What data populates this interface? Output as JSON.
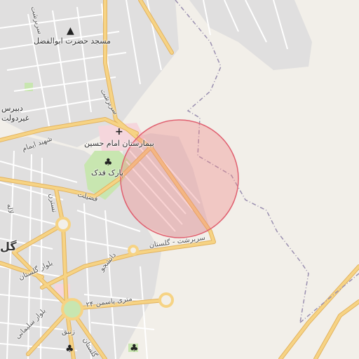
{
  "map": {
    "colors": {
      "background": "#f2efe9",
      "residential": "#e0dfdf",
      "road_major": "#f6d384",
      "road_casing": "#e3b35f",
      "road_minor": "#ffffff",
      "park": "#c8e6b0",
      "hospital": "#f5d6dc",
      "boundary": "#9a8fb0",
      "radius_fill": "#f08080",
      "radius_stroke": "#e06070"
    },
    "labels": {
      "mosque": "مسجد حضرت ابوالفضل",
      "hospital": "بیمارستان امام حسین",
      "park": "پارک فدک",
      "dabirestan": "دبیرس",
      "ghirdolat": "غیردولت",
      "sarbedasht_road_top": "سربرشت",
      "sarbedasht_road_mid": "سربرشت",
      "shahid_beheshti": "شهید ایمام",
      "fazilat": "فضیلت",
      "nastaran": "نسترن",
      "golestan_blvd": "سربرشت - گلستان",
      "danesh": "دانشجو",
      "boulevard_golestan": "بلوار گلستان",
      "yasaman": "۲۴ متری یاسمن",
      "zanbagh": "زنبق",
      "solimani": "بلوار سلیمانی",
      "golestan_bottom": "گلستان",
      "gol_left": "گل",
      "left_vertical": "لاله"
    },
    "icons": {
      "mosque": "mosque-icon",
      "hospital": "hospital-cross-icon",
      "park": "tree-icon"
    }
  }
}
